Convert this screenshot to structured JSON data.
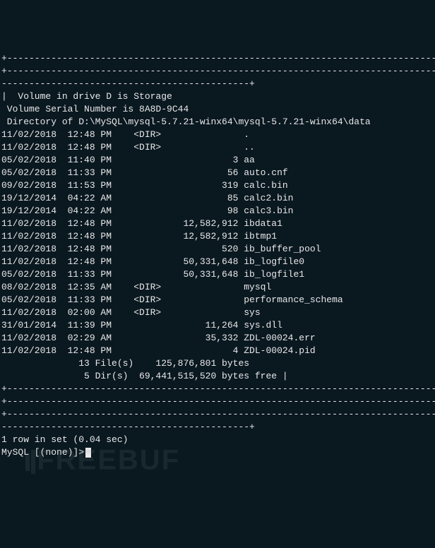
{
  "rule_top": "+---------------------------------------------------------------------------------------------------------------------------------+",
  "vol_line": "|  Volume in drive D is Storage",
  "serial_line": " Volume Serial Number is 8A8D-9C44",
  "blank": "",
  "dir_of": " Directory of D:\\MySQL\\mysql-5.7.21-winx64\\mysql-5.7.21-winx64\\data",
  "entries": [
    {
      "date": "11/02/2018",
      "time": "12:48 PM",
      "dir": true,
      "size": "",
      "name": "."
    },
    {
      "date": "11/02/2018",
      "time": "12:48 PM",
      "dir": true,
      "size": "",
      "name": ".."
    },
    {
      "date": "05/02/2018",
      "time": "11:40 PM",
      "dir": false,
      "size": "3",
      "name": "aa"
    },
    {
      "date": "05/02/2018",
      "time": "11:33 PM",
      "dir": false,
      "size": "56",
      "name": "auto.cnf"
    },
    {
      "date": "09/02/2018",
      "time": "11:53 PM",
      "dir": false,
      "size": "319",
      "name": "calc.bin"
    },
    {
      "date": "19/12/2014",
      "time": "04:22 AM",
      "dir": false,
      "size": "85",
      "name": "calc2.bin"
    },
    {
      "date": "19/12/2014",
      "time": "04:22 AM",
      "dir": false,
      "size": "98",
      "name": "calc3.bin"
    },
    {
      "date": "11/02/2018",
      "time": "12:48 PM",
      "dir": false,
      "size": "12,582,912",
      "name": "ibdata1"
    },
    {
      "date": "11/02/2018",
      "time": "12:48 PM",
      "dir": false,
      "size": "12,582,912",
      "name": "ibtmp1"
    },
    {
      "date": "11/02/2018",
      "time": "12:48 PM",
      "dir": false,
      "size": "520",
      "name": "ib_buffer_pool"
    },
    {
      "date": "11/02/2018",
      "time": "12:48 PM",
      "dir": false,
      "size": "50,331,648",
      "name": "ib_logfile0"
    },
    {
      "date": "05/02/2018",
      "time": "11:33 PM",
      "dir": false,
      "size": "50,331,648",
      "name": "ib_logfile1"
    },
    {
      "date": "08/02/2018",
      "time": "12:35 AM",
      "dir": true,
      "size": "",
      "name": "mysql"
    },
    {
      "date": "05/02/2018",
      "time": "11:33 PM",
      "dir": true,
      "size": "",
      "name": "performance_schema"
    },
    {
      "date": "11/02/2018",
      "time": "02:00 AM",
      "dir": true,
      "size": "",
      "name": "sys"
    },
    {
      "date": "31/01/2014",
      "time": "11:39 PM",
      "dir": false,
      "size": "11,264",
      "name": "sys.dll"
    },
    {
      "date": "11/02/2018",
      "time": "02:29 AM",
      "dir": false,
      "size": "35,332",
      "name": "ZDL-00024.err"
    },
    {
      "date": "11/02/2018",
      "time": "12:48 PM",
      "dir": false,
      "size": "4",
      "name": "ZDL-00024.pid"
    }
  ],
  "summary_files": "              13 File(s)    125,876,801 bytes",
  "summary_dirs": "               5 Dir(s)  69,441,515,520 bytes free |",
  "rule_mid": "+---------------------------------------------------------------------------------------------------------------------------------+",
  "status": "1 row in set (0.04 sec)",
  "prompt": "MySQL [(none)]>",
  "watermark": "FREEBUF"
}
